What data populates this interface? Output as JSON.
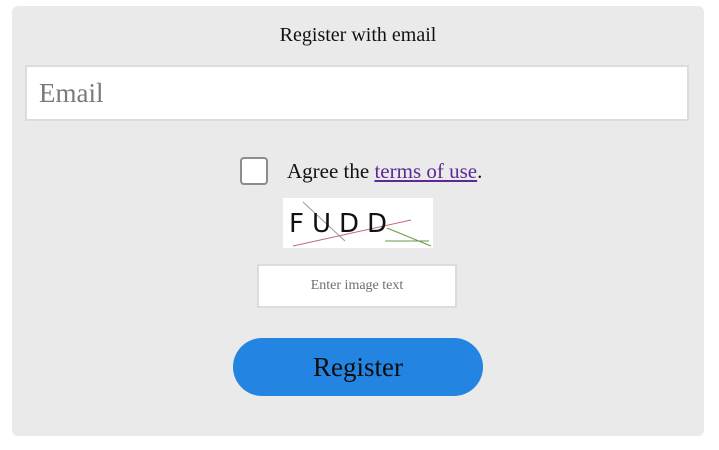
{
  "form": {
    "title": "Register with email",
    "email_placeholder": "Email",
    "agree_prefix": "Agree the ",
    "terms_link": "terms of use",
    "agree_suffix": ".",
    "captcha_text": "FUDD",
    "captcha_placeholder": "Enter image text",
    "register_label": "Register"
  },
  "colors": {
    "panel_bg": "#eaeaea",
    "button_bg": "#2384e1",
    "link": "#5b2a96"
  },
  "icons": {
    "checkbox": "checkbox-unchecked-icon"
  }
}
